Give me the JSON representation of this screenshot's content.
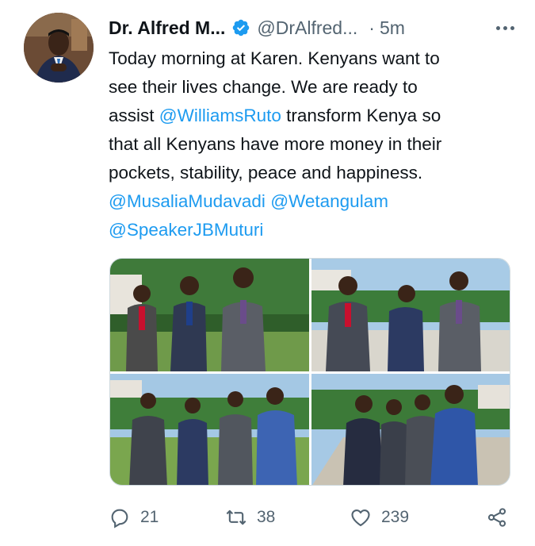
{
  "tweet": {
    "author_name": "Dr. Alfred M...",
    "handle": "@DrAlfred...",
    "separator": "·",
    "timestamp": "5m",
    "text_lines": [
      {
        "segments": [
          {
            "text": "Today morning at Karen. Kenyans want to",
            "type": "text"
          }
        ]
      },
      {
        "segments": [
          {
            "text": "see their lives change. We are ready to",
            "type": "text"
          }
        ]
      },
      {
        "segments": [
          {
            "text": "assist ",
            "type": "text"
          },
          {
            "text": "@WilliamsRuto",
            "type": "mention"
          },
          {
            "text": " transform Kenya so",
            "type": "text"
          }
        ]
      },
      {
        "segments": [
          {
            "text": "that all Kenyans have more money in their",
            "type": "text"
          }
        ]
      },
      {
        "segments": [
          {
            "text": "pockets, stability, peace and happiness.",
            "type": "text"
          }
        ]
      },
      {
        "segments": [
          {
            "text": "@MusaliaMudavadi",
            "type": "mention"
          },
          {
            "text": " ",
            "type": "text"
          },
          {
            "text": "@Wetangulam",
            "type": "mention"
          }
        ]
      },
      {
        "segments": [
          {
            "text": "@SpeakerJBMuturi",
            "type": "mention"
          }
        ]
      }
    ],
    "photos": [
      {
        "name": "photo-1",
        "alt": "Four men in suits standing outdoors"
      },
      {
        "name": "photo-2",
        "alt": "Three men in suits laughing outdoors"
      },
      {
        "name": "photo-3",
        "alt": "Four men greeting on a garden lawn"
      },
      {
        "name": "photo-4",
        "alt": "Men in suits chatting on a walkway"
      }
    ],
    "actions": {
      "reply_count": "21",
      "retweet_count": "38",
      "like_count": "239"
    }
  },
  "icons": {
    "verified": "verified-badge-icon",
    "more": "more-options-icon",
    "reply": "reply-icon",
    "retweet": "retweet-icon",
    "like": "heart-icon",
    "share": "share-icon"
  },
  "colors": {
    "accent": "#1d9bf0",
    "text": "#0f1419",
    "secondary": "#536471"
  }
}
